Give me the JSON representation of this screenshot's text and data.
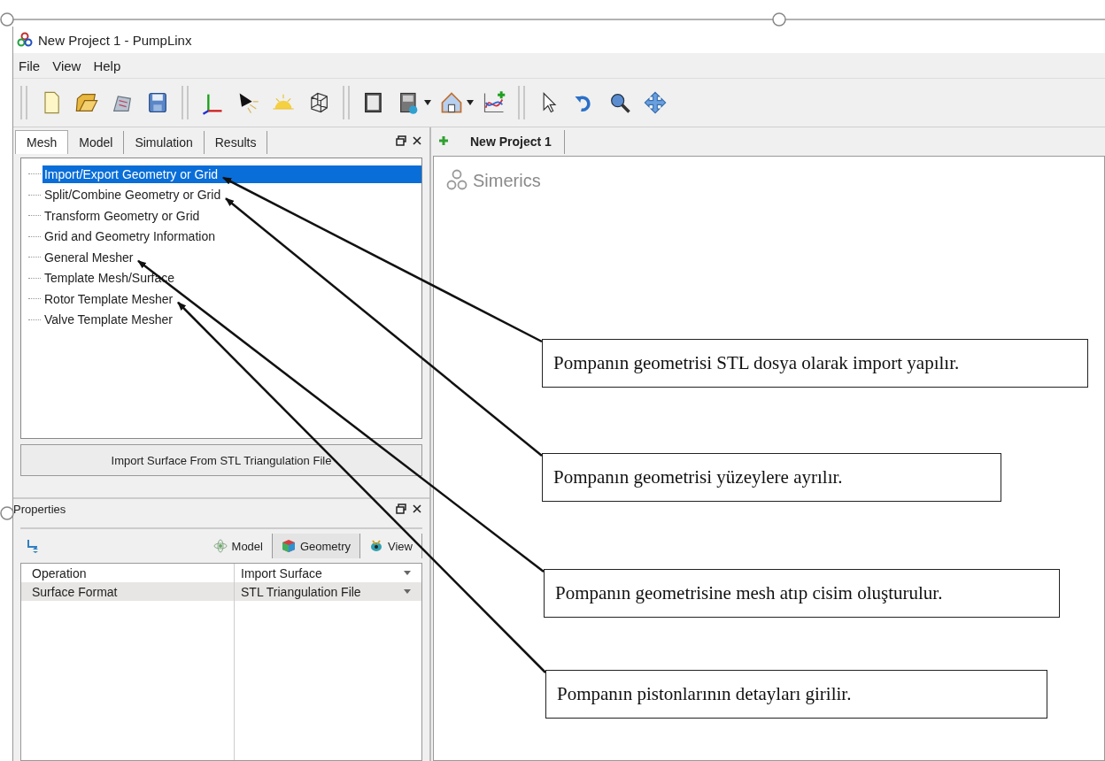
{
  "window": {
    "title": "New Project 1 - PumpLinx"
  },
  "menu": [
    "File",
    "View",
    "Help"
  ],
  "left_tabs": [
    {
      "label": "Mesh",
      "selected": true
    },
    {
      "label": "Model",
      "selected": false
    },
    {
      "label": "Simulation",
      "selected": false
    },
    {
      "label": "Results",
      "selected": false
    }
  ],
  "tree": [
    {
      "label": "Import/Export Geometry or Grid",
      "selected": true
    },
    {
      "label": "Split/Combine Geometry or Grid",
      "selected": false
    },
    {
      "label": "Transform Geometry or Grid",
      "selected": false
    },
    {
      "label": "Grid and Geometry Information",
      "selected": false
    },
    {
      "label": "General Mesher",
      "selected": false
    },
    {
      "label": "Template Mesh/Surface",
      "selected": false
    },
    {
      "label": "Rotor Template Mesher",
      "selected": false
    },
    {
      "label": "Valve Template Mesher",
      "selected": false
    }
  ],
  "action_button": "Import Surface From STL Triangulation File",
  "properties": {
    "title": "Properties",
    "tabs": [
      {
        "label": "Model",
        "selected": false
      },
      {
        "label": "Geometry",
        "selected": true
      },
      {
        "label": "View",
        "selected": false
      }
    ],
    "rows": [
      {
        "name": "Operation",
        "value": "Import Surface",
        "selected": false
      },
      {
        "name": "Surface Format",
        "value": "STL Triangulation File",
        "selected": true
      }
    ]
  },
  "document_tabs": [
    {
      "label": "New Project 1",
      "selected": true
    }
  ],
  "canvas": {
    "logo": "Simerics"
  },
  "annotations": [
    {
      "text": "Pompanın geometrisi STL dosya olarak import yapılır."
    },
    {
      "text": "Pompanın geometrisi yüzeylere ayrılır."
    },
    {
      "text": "Pompanın geometrisine mesh atıp cisim oluşturulur."
    },
    {
      "text": "Pompanın pistonlarının detayları girilir."
    }
  ]
}
